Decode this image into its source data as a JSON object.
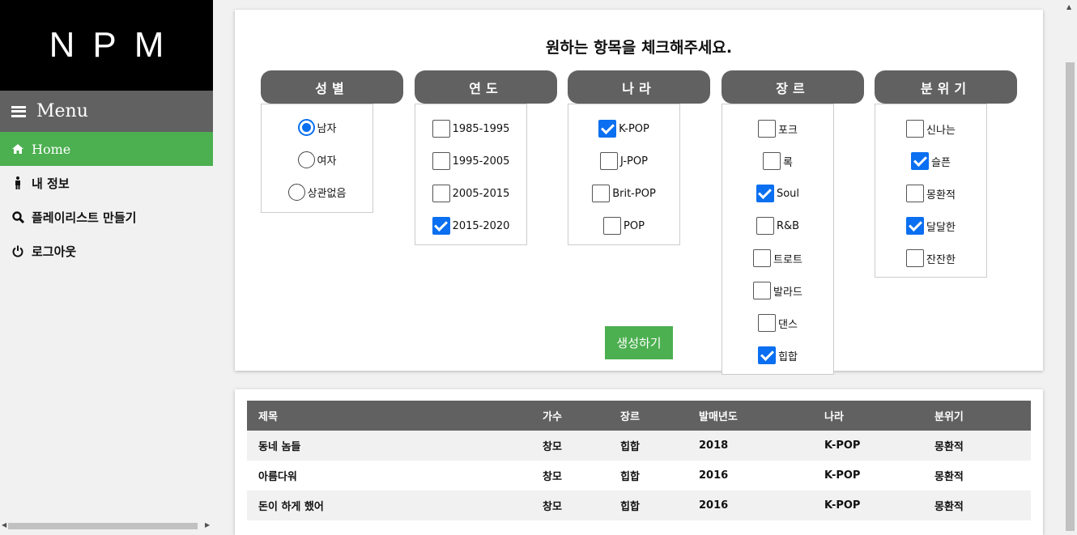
{
  "sidebar": {
    "brand": "NPM",
    "menu_label": "Menu",
    "items": [
      {
        "label": "Home",
        "icon": "home-icon",
        "active": true
      },
      {
        "label": "내 정보",
        "icon": "person-icon"
      },
      {
        "label": "플레이리스트 만들기",
        "icon": "search-icon"
      },
      {
        "label": "로그아웃",
        "icon": "power-icon"
      }
    ]
  },
  "form": {
    "title": "원하는 항목을 체크해주세요.",
    "generate_label": "생성하기",
    "columns": [
      {
        "head": "성별",
        "type": "radio",
        "options": [
          {
            "label": "남자",
            "checked": true
          },
          {
            "label": "여자",
            "checked": false
          },
          {
            "label": "상관없음",
            "checked": false
          }
        ]
      },
      {
        "head": "연도",
        "type": "checkbox",
        "options": [
          {
            "label": "1985-1995",
            "checked": false
          },
          {
            "label": "1995-2005",
            "checked": false
          },
          {
            "label": "2005-2015",
            "checked": false
          },
          {
            "label": "2015-2020",
            "checked": true
          }
        ]
      },
      {
        "head": "나라",
        "type": "checkbox",
        "options": [
          {
            "label": "K-POP",
            "checked": true
          },
          {
            "label": "J-POP",
            "checked": false
          },
          {
            "label": "Brit-POP",
            "checked": false
          },
          {
            "label": "POP",
            "checked": false
          }
        ]
      },
      {
        "head": "장르",
        "type": "checkbox",
        "options": [
          {
            "label": "포크",
            "checked": false
          },
          {
            "label": "록",
            "checked": false
          },
          {
            "label": "Soul",
            "checked": true
          },
          {
            "label": "R&B",
            "checked": false
          },
          {
            "label": "트로트",
            "checked": false
          },
          {
            "label": "발라드",
            "checked": false
          },
          {
            "label": "댄스",
            "checked": false
          },
          {
            "label": "힙합",
            "checked": true
          }
        ]
      },
      {
        "head": "분위기",
        "type": "checkbox",
        "options": [
          {
            "label": "신나는",
            "checked": false
          },
          {
            "label": "슬픈",
            "checked": true
          },
          {
            "label": "몽환적",
            "checked": false
          },
          {
            "label": "달달한",
            "checked": true
          },
          {
            "label": "잔잔한",
            "checked": false
          }
        ]
      }
    ]
  },
  "table": {
    "headers": [
      "제목",
      "가수",
      "장르",
      "발매년도",
      "나라",
      "분위기"
    ],
    "rows": [
      [
        "동네 놈들",
        "창모",
        "힙합",
        "2018",
        "K-POP",
        "몽환적"
      ],
      [
        "아름다워",
        "창모",
        "힙합",
        "2016",
        "K-POP",
        "몽환적"
      ],
      [
        "돈이 하게 했어",
        "창모",
        "힙합",
        "2016",
        "K-POP",
        "몽환적"
      ]
    ]
  },
  "colors": {
    "accent": "#4caf50",
    "header": "#616161",
    "check": "#0a6ff0"
  }
}
